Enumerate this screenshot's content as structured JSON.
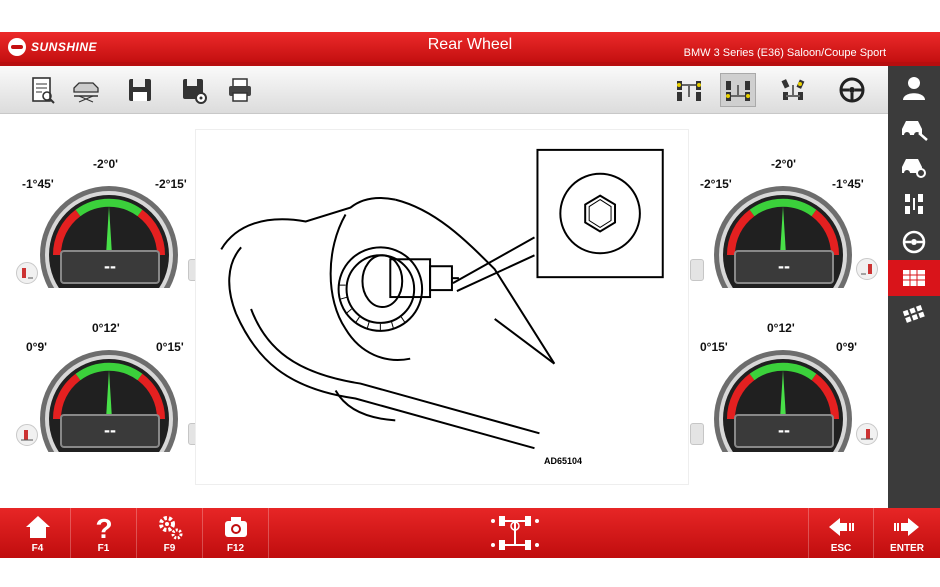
{
  "header": {
    "brand": "SUNSHINE",
    "title": "Rear Wheel",
    "vehicle": "BMW 3 Series (E36) Saloon/Coupe Sport"
  },
  "toolbar": {
    "left_tools": [
      "report-icon",
      "vehicle-lift-icon",
      "save-icon",
      "save-settings-icon",
      "print-icon"
    ],
    "right_tools": [
      "front-axle-view-icon",
      "rear-axle-view-icon",
      "adjust-view-icon",
      "steering-wheel-icon"
    ],
    "active_tool": "rear-axle-view-icon"
  },
  "gauges": {
    "left_top": {
      "left_label": "-1°45'",
      "center_label": "-2°0'",
      "right_label": "-2°15'",
      "reading": "--"
    },
    "left_bottom": {
      "left_label": "0°9'",
      "center_label": "0°12'",
      "right_label": "0°15'",
      "reading": "--"
    },
    "right_top": {
      "left_label": "-2°15'",
      "center_label": "-2°0'",
      "right_label": "-1°45'",
      "reading": "--"
    },
    "right_bottom": {
      "left_label": "0°15'",
      "center_label": "0°12'",
      "right_label": "0°9'",
      "reading": "--"
    }
  },
  "diagram": {
    "code": "AD65104"
  },
  "sidebar": {
    "items": [
      "user-icon",
      "car-service-icon",
      "car-search-icon",
      "wheel-alignment-icon",
      "steering-icon",
      "specs-table-icon",
      "grid-icon"
    ],
    "active": "specs-table-icon"
  },
  "footer": {
    "buttons": [
      {
        "icon": "home-icon",
        "key": "F4"
      },
      {
        "icon": "help-icon",
        "key": "F1"
      },
      {
        "icon": "settings-icon",
        "key": "F9"
      },
      {
        "icon": "camera-icon",
        "key": "F12"
      }
    ],
    "esc_key": "ESC",
    "enter_key": "ENTER"
  },
  "colors": {
    "brand_red": "#d9141a",
    "gauge_green": "#3bd13b",
    "gauge_red": "#e42020",
    "sidebar_bg": "#3b3b3b"
  }
}
